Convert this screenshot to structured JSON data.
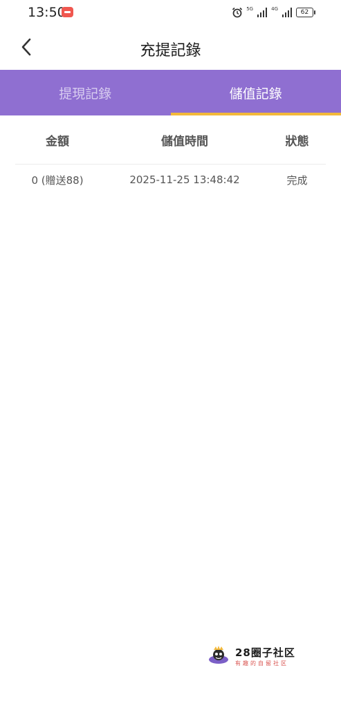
{
  "status_bar": {
    "time": "13:50",
    "network_1": "5G",
    "network_2": "4G",
    "battery": "62"
  },
  "header": {
    "title": "充提記錄"
  },
  "tabs": [
    {
      "label": "提現記錄",
      "active": false
    },
    {
      "label": "儲值記錄",
      "active": true
    }
  ],
  "table": {
    "headers": [
      "金額",
      "儲值時間",
      "狀態"
    ],
    "rows": [
      {
        "amount": "0 (贈送88)",
        "time": "2025-11-25 13:48:42",
        "status": "完成"
      }
    ]
  },
  "watermark": {
    "name": "28圈子社区",
    "subtitle": "有趣的自留社区"
  },
  "colors": {
    "tab_bar": "#8f6fd1",
    "tab_indicator": "#f3b93b",
    "notification": "#f0574f"
  }
}
